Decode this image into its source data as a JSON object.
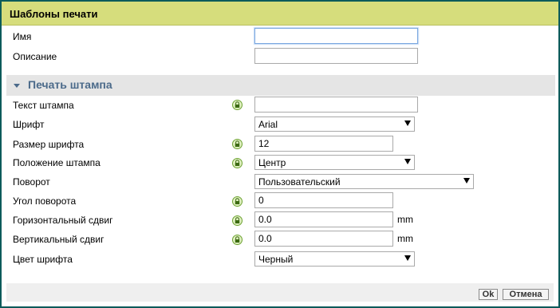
{
  "dialog": {
    "title": "Шаблоны печати"
  },
  "general": {
    "name_label": "Имя",
    "name_value": "",
    "description_label": "Описание",
    "description_value": ""
  },
  "stamp_section": {
    "title": "Печать штампа",
    "text_label": "Текст штампа",
    "text_value": "",
    "font_label": "Шрифт",
    "font_value": "Arial",
    "font_size_label": "Размер шрифта",
    "font_size_value": "12",
    "position_label": "Положение штампа",
    "position_value": "Центр",
    "rotation_label": "Поворот",
    "rotation_value": "Пользовательский",
    "angle_label": "Угол поворота",
    "angle_value": "0",
    "h_shift_label": "Горизонтальный сдвиг",
    "h_shift_value": "0.0",
    "h_shift_unit": "mm",
    "v_shift_label": "Вертикальный сдвиг",
    "v_shift_value": "0.0",
    "v_shift_unit": "mm",
    "color_label": "Цвет шрифта",
    "color_value": "Черный"
  },
  "buttons": {
    "ok": "Ok",
    "cancel": "Отмена"
  },
  "icons": {
    "lock": "lock-icon",
    "collapse": "triangle-down-icon"
  },
  "colors": {
    "titlebar": "#d6dd7c",
    "border": "#0c5b5b",
    "section_text": "#4b6a8a",
    "lock_green": "#6ea233"
  }
}
